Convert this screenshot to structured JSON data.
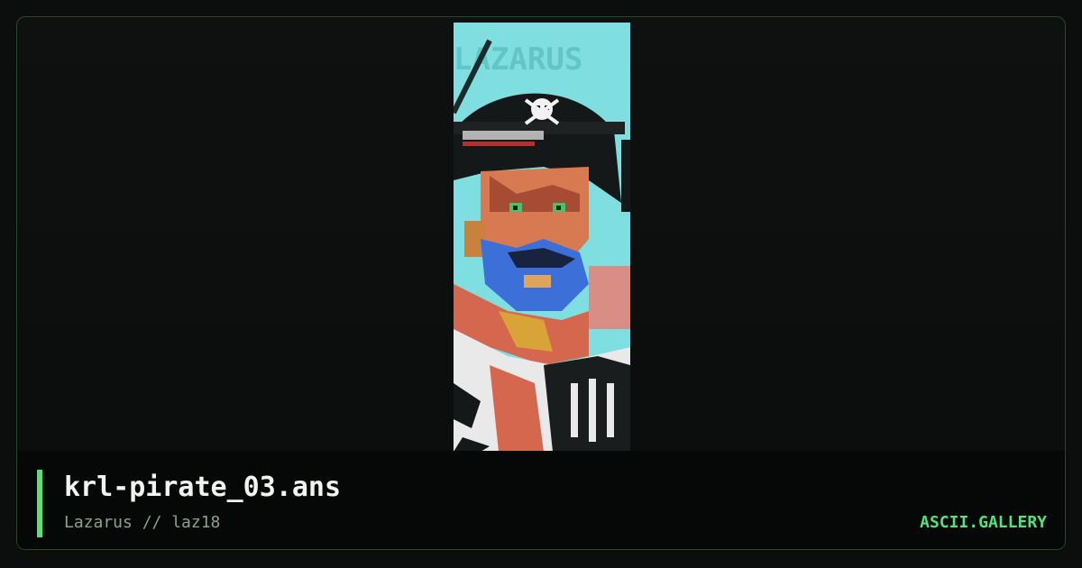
{
  "artwork": {
    "filename": "krl-pirate_03.ans",
    "credit": "Lazarus // laz18",
    "signature_lettering": "LAZARUS"
  },
  "branding": {
    "site_name": "ASCII.GALLERY"
  },
  "colors": {
    "accent": "#56e27a",
    "frame_border": "#234a2a",
    "background": "#0b0e0c",
    "title_text": "#f2f4f2",
    "subtitle_text": "#8aa18f"
  },
  "icons": [
    "pirate-ansi-artwork",
    "skull-and-crossbones-icon"
  ]
}
